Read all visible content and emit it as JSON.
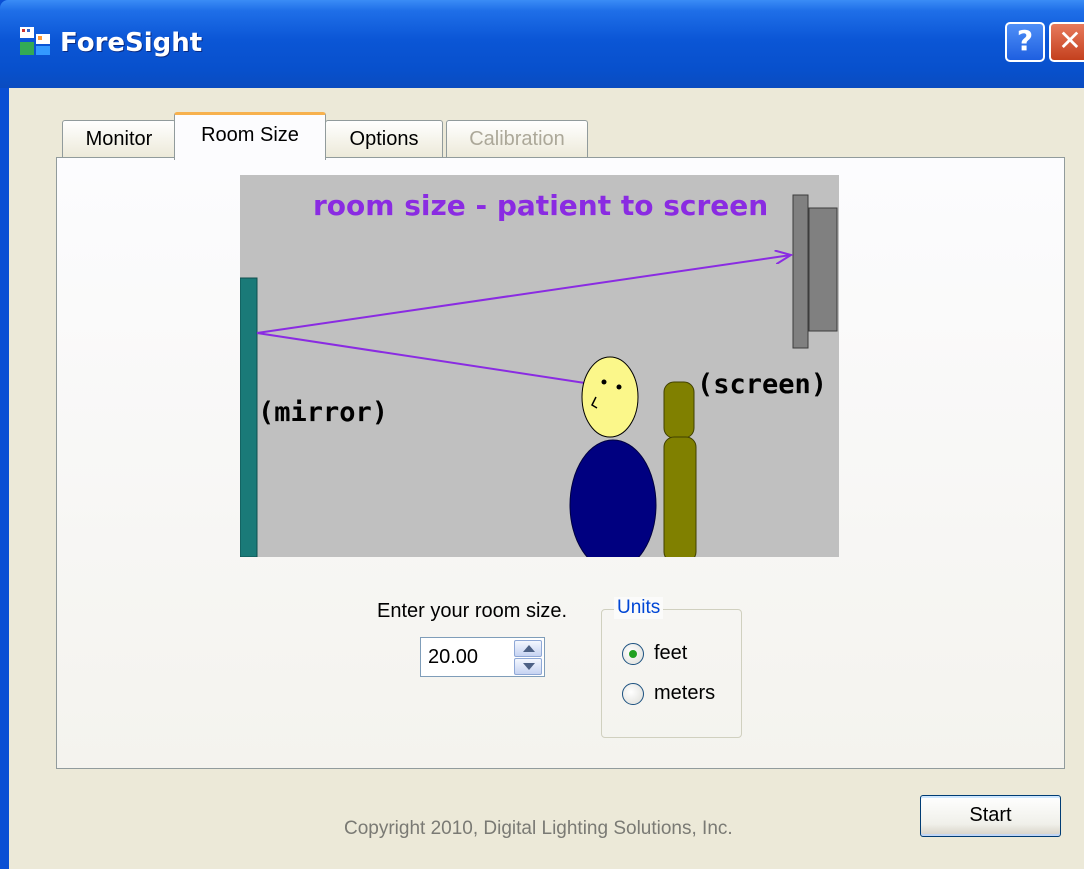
{
  "window": {
    "title": "ForeSight",
    "help_label": "?",
    "close_label": "✕"
  },
  "tabs": [
    {
      "label": "Monitor",
      "state": "normal"
    },
    {
      "label": "Room Size",
      "state": "active"
    },
    {
      "label": "Options",
      "state": "normal"
    },
    {
      "label": "Calibration",
      "state": "disabled"
    }
  ],
  "illustration": {
    "heading": "room size - patient to screen",
    "mirror_label": "(mirror)",
    "screen_label": "(screen)",
    "colors": {
      "background": "#c0c0c0",
      "heading": "#8a2be2",
      "line": "#8a2be2",
      "mirror": "#1a7a78",
      "screen": "#808080",
      "head": "#fbf78a",
      "body": "#000080",
      "chair": "#808000"
    }
  },
  "room_size": {
    "prompt": "Enter your room size.",
    "value": "20.00"
  },
  "units": {
    "label": "Units",
    "options": [
      {
        "label": "feet",
        "selected": true
      },
      {
        "label": "meters",
        "selected": false
      }
    ]
  },
  "footer": {
    "copyright": "Copyright 2010, Digital Lighting Solutions, Inc.",
    "start_label": "Start"
  }
}
